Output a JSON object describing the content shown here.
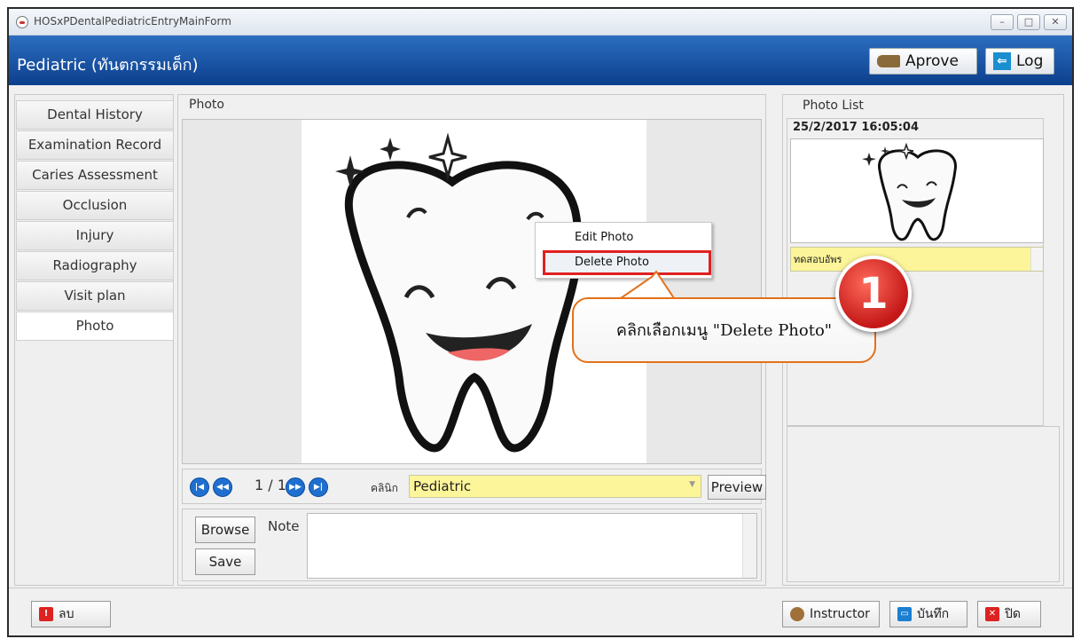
{
  "window": {
    "title": "HOSxPDentalPediatricEntryMainForm",
    "controls": [
      "–",
      "□",
      "✕"
    ]
  },
  "header": {
    "title": "Pediatric (ทันตกรรมเด็ก)",
    "aprove_label": "Aprove",
    "log_label": "Log"
  },
  "sidebar": {
    "items": [
      {
        "label": "Dental History"
      },
      {
        "label": "Examination Record"
      },
      {
        "label": "Caries Assessment"
      },
      {
        "label": "Occlusion"
      },
      {
        "label": "Injury"
      },
      {
        "label": "Radiography"
      },
      {
        "label": "Visit plan"
      },
      {
        "label": "Photo",
        "active": true
      }
    ]
  },
  "photo": {
    "title": "Photo",
    "page_counter": "1 / 1",
    "clinic_label": "คลินิก",
    "clinic_value": "Pediatric",
    "preview_label": "Preview",
    "browse_label": "Browse",
    "save_label": "Save",
    "note_label": "Note"
  },
  "photo_list": {
    "title": "Photo List",
    "entries": [
      {
        "datetime": "25/2/2017 16:05:04",
        "note": "ทดสอบอัพร"
      }
    ]
  },
  "context_menu": {
    "items": [
      {
        "label": "Edit Photo"
      },
      {
        "label": "Delete Photo"
      }
    ]
  },
  "annotation": {
    "step": "1",
    "callout": "คลิกเลือกเมนู \"Delete Photo\"",
    "accent_color": "#e02020",
    "callout_border": "#e3711a"
  },
  "footer": {
    "delete_label": "ลบ",
    "instructor_label": "Instructor",
    "save_label": "บันทึก",
    "close_label": "ปิด"
  },
  "colors": {
    "header_blue": "#0c3f8d",
    "field_yellow": "#fdf59a",
    "nav_blue": "#1e6fd0"
  }
}
